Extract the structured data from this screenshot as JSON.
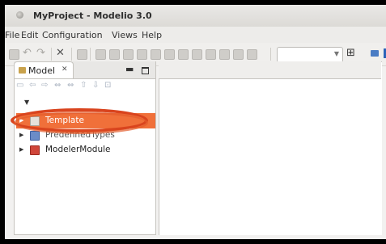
{
  "window": {
    "title": "MyProject - Modelio 3.0"
  },
  "menu": [
    "File",
    "Edit",
    "Configuration",
    "Views",
    "Help"
  ],
  "model_view": {
    "tab_label": "Model",
    "tree": [
      {
        "label": "Template",
        "selected": true
      },
      {
        "label": "PredefinedTypes",
        "selected": false
      },
      {
        "label": "ModelerModule",
        "selected": false
      }
    ]
  },
  "colors": {
    "selection": "#f0703a",
    "highlight_annotation": "#d9441e"
  }
}
